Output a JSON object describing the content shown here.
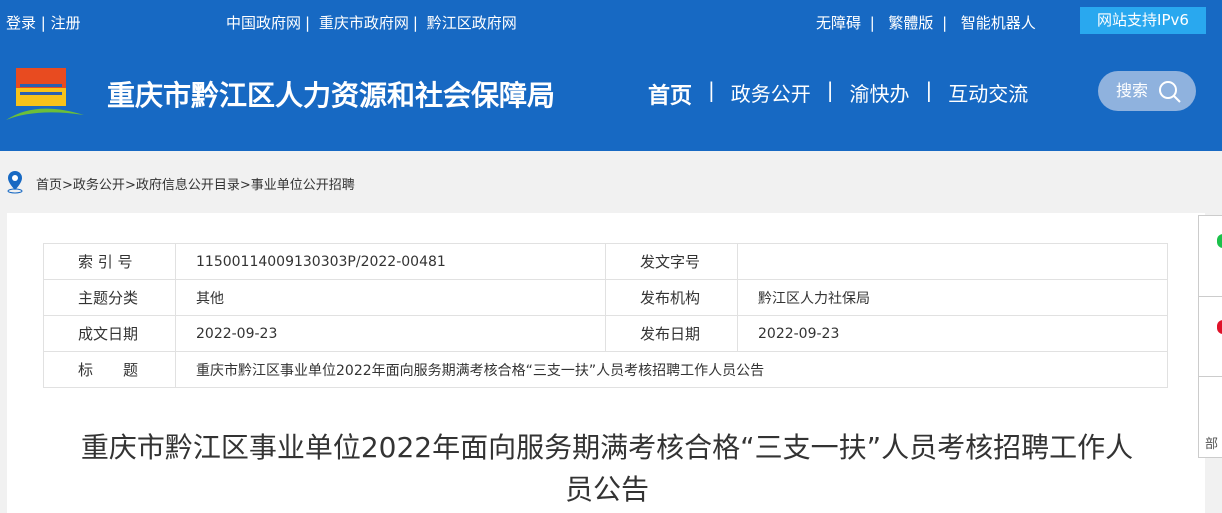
{
  "topbar": {
    "login": "登录",
    "register": "注册",
    "links": [
      "中国政府网",
      "重庆市政府网",
      "黔江区政府网"
    ],
    "right": [
      "无障碍",
      "繁體版",
      "智能机器人"
    ],
    "ipv6": "网站支持IPv6"
  },
  "header": {
    "site_title": "重庆市黔江区人力资源和社会保障局",
    "nav": [
      "首页",
      "政务公开",
      "渝快办",
      "互动交流"
    ],
    "search": "搜索"
  },
  "breadcrumb": [
    "首页",
    "政务公开",
    "政府信息公开目录",
    "事业单位公开招聘"
  ],
  "info": {
    "index_label": "索 引 号",
    "index": "11500114009130303P/2022-00481",
    "docno_label": "发文字号",
    "docno": "",
    "topic_label": "主题分类",
    "topic": "其他",
    "org_label": "发布机构",
    "org": "黔江区人力社保局",
    "date_label": "成文日期",
    "date": "2022-09-23",
    "pub_label": "发布日期",
    "pub": "2022-09-23",
    "title_label": "标　　题",
    "title": "重庆市黔江区事业单位2022年面向服务期满考核合格“三支一扶”人员考核招聘工作人员公告"
  },
  "article_title": "重庆市黔江区事业单位2022年面向服务期满考核合格“三支一扶”人员考核招聘工作人员公告",
  "side": {
    "partial": "部"
  }
}
